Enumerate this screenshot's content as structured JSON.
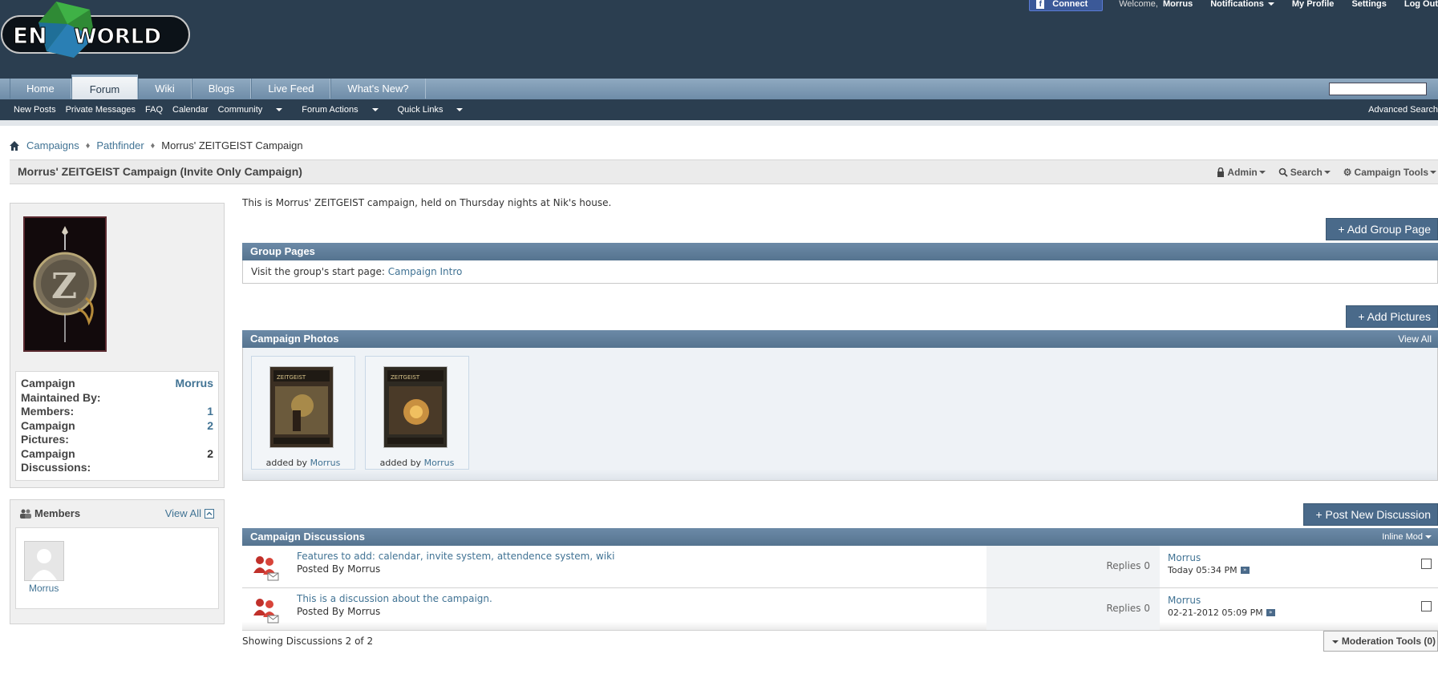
{
  "header": {
    "facebook_connect": "Connect",
    "welcome": "Welcome,",
    "username": "Morrus",
    "notifications": "Notifications",
    "my_profile": "My Profile",
    "settings": "Settings",
    "log_out": "Log Out"
  },
  "nav": {
    "tabs": [
      "Home",
      "Forum",
      "Wiki",
      "Blogs",
      "Live Feed",
      "What's New?"
    ],
    "active_tab": "Forum"
  },
  "subnav": {
    "links": [
      "New Posts",
      "Private Messages",
      "FAQ",
      "Calendar",
      "Community",
      "Forum Actions",
      "Quick Links"
    ],
    "advanced_search": "Advanced Search"
  },
  "breadcrumb": {
    "items": [
      "Campaigns",
      "Pathfinder"
    ],
    "current": "Morrus' ZEITGEIST Campaign"
  },
  "titlebar": {
    "title": "Morrus' ZEITGEIST Campaign (Invite Only Campaign)",
    "admin": "Admin",
    "search": "Search",
    "campaign_tools": "Campaign Tools"
  },
  "sidebar": {
    "stats": [
      {
        "label": "Campaign Maintained By:",
        "value": "Morrus"
      },
      {
        "label": "Members:",
        "value": "1"
      },
      {
        "label": "Campaign Pictures:",
        "value": "2"
      },
      {
        "label": "Campaign Discussions:",
        "value": "2"
      }
    ],
    "members_title": "Members",
    "members_view_all": "View All",
    "member_name": "Morrus"
  },
  "main": {
    "description": "This is Morrus' ZEITGEIST campaign, held on Thursday nights at Nik's house.",
    "add_group_page": "+ Add Group Page",
    "group_pages_title": "Group Pages",
    "group_pages_text": "Visit the group's start page:",
    "group_pages_link": "Campaign Intro",
    "add_pictures": "+ Add Pictures",
    "photos_title": "Campaign Photos",
    "photos_view_all": "View All",
    "photos": [
      {
        "added_by": "added by",
        "user": "Morrus"
      },
      {
        "added_by": "added by",
        "user": "Morrus"
      }
    ],
    "post_new_discussion": "+ Post New Discussion",
    "discussions_title": "Campaign Discussions",
    "inline_mod": "Inline Mod",
    "discussions": [
      {
        "title": "Features to add: calendar, invite system, attendence system, wiki",
        "posted_by": "Posted By Morrus",
        "replies": "Replies 0",
        "last_user": "Morrus",
        "last_date": "Today 05:34 PM"
      },
      {
        "title": "This is a discussion about the campaign.",
        "posted_by": "Posted By Morrus",
        "replies": "Replies 0",
        "last_user": "Morrus",
        "last_date": "02-21-2012 05:09 PM"
      }
    ],
    "showing": "Showing Discussions 2 of 2",
    "moderation_tools": "Moderation Tools (0)"
  },
  "colors": {
    "header_bg": "#2b3e50",
    "nav_bg": "#7f9bb5",
    "block_head": "#5f7e9a",
    "link": "#417394",
    "button": "#4a6a8a"
  }
}
